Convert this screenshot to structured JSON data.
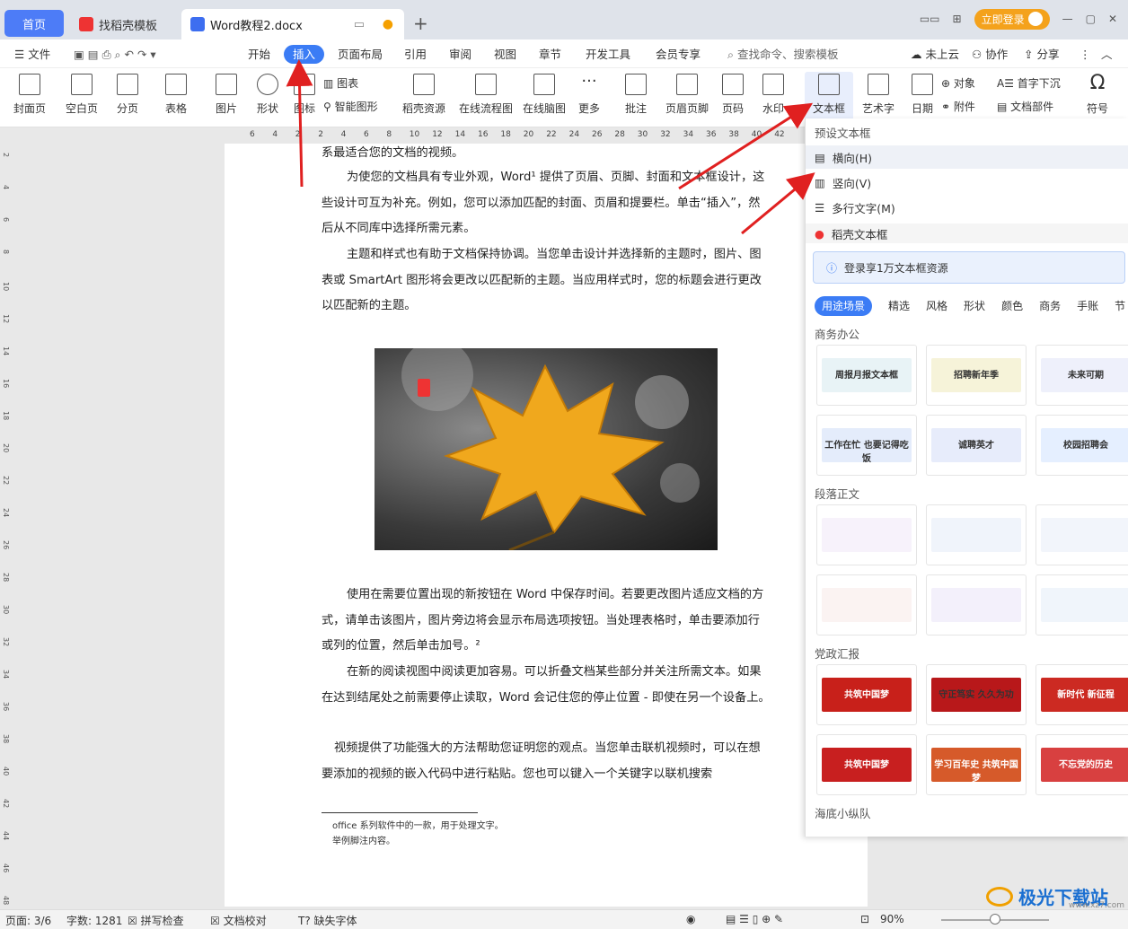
{
  "tabs": {
    "home": "首页",
    "daoke": "找稻壳模板",
    "doc": "Word教程2.docx"
  },
  "window": {
    "login": "立即登录"
  },
  "menu": [
    "文件",
    "开始",
    "插入",
    "页面布局",
    "引用",
    "审阅",
    "视图",
    "章节",
    "开发工具",
    "会员专享"
  ],
  "menu_right": {
    "search": "查找命令、搜索模板",
    "cloud": "未上云",
    "collab": "协作",
    "share": "分享"
  },
  "ribbon": [
    "封面页",
    "空白页",
    "分页",
    "表格",
    "图片",
    "形状",
    "图标",
    "稻壳资源",
    "在线流程图",
    "在线脑图",
    "更多",
    "批注",
    "页眉页脚",
    "页码",
    "水印",
    "文本框",
    "艺术字",
    "日期",
    "附件",
    "符号"
  ],
  "ribbon_small": {
    "chart": "图表",
    "smart": "智能图形",
    "object": "对象",
    "dropcap": "首字下沉",
    "docpart": "文档部件"
  },
  "ruler_ticks": [
    "6",
    "4",
    "2",
    "2",
    "4",
    "6",
    "8",
    "10",
    "12",
    "14",
    "16",
    "18",
    "20",
    "22",
    "24",
    "26",
    "28",
    "30",
    "32",
    "34",
    "36",
    "38",
    "40",
    "42"
  ],
  "doc": {
    "p0": "系最适合您的文档的视频。",
    "p1": "为使您的文档具有专业外观，Word¹ 提供了页眉、页脚、封面和文本框设计，这些设计可互为补充。例如，您可以添加匹配的封面、页眉和提要栏。单击“插入”，然后从不同库中选择所需元素。",
    "p2": "主题和样式也有助于文档保持协调。当您单击设计并选择新的主题时，图片、图表或 SmartArt 图形将会更改以匹配新的主题。当应用样式时，您的标题会进行更改以匹配新的主题。",
    "p3": "使用在需要位置出现的新按钮在 Word 中保存时间。若要更改图片适应文档的方式，请单击该图片，图片旁边将会显示布局选项按钮。当处理表格时，单击要添加行或列的位置，然后单击加号。²",
    "p4": "在新的阅读视图中阅读更加容易。可以折叠文档某些部分并关注所需文本。如果在达到结尾处之前需要停止读取，Word 会记住您的停止位置 - 即使在另一个设备上。",
    "p5": "视频提供了功能强大的方法帮助您证明您的观点。当您单击联机视频时，可以在想要添加的视频的嵌入代码中进行粘贴。您也可以键入一个关键字以联机搜索",
    "fn1": "office 系列软件中的一款，用于处理文字。",
    "fn2": "举例脚注内容。"
  },
  "panel": {
    "preset": "预设文本框",
    "h": "横向(H)",
    "v": "竖向(V)",
    "m": "多行文字(M)",
    "daoke": "稻壳文本框",
    "promo": "登录享1万文本框资源",
    "cats": [
      "用途场景",
      "精选",
      "风格",
      "形状",
      "颜色",
      "商务",
      "手账",
      "节"
    ],
    "s1": "商务办公",
    "s2": "段落正文",
    "s3": "党政汇报",
    "s4": "海底小纵队",
    "tiles1": [
      "周报月报文本框",
      "招聘新年季",
      "未来可期",
      "工作在忙 也要记得吃饭",
      "诚聘英才",
      "校园招聘会"
    ],
    "tiles3": [
      "共筑中国梦",
      "守正笃实 久久为功",
      "新时代 新征程",
      "共筑中国梦",
      "学习百年史 共筑中国梦",
      "不忘党的历史"
    ]
  },
  "status": {
    "page": "页面: 3/6",
    "words": "字数: 1281",
    "spell": "拼写检查",
    "proof": "文档校对",
    "font": "缺失字体",
    "zoom": "90%"
  },
  "watermark": "极光下载站",
  "watermark_url": "www.xz7.com"
}
